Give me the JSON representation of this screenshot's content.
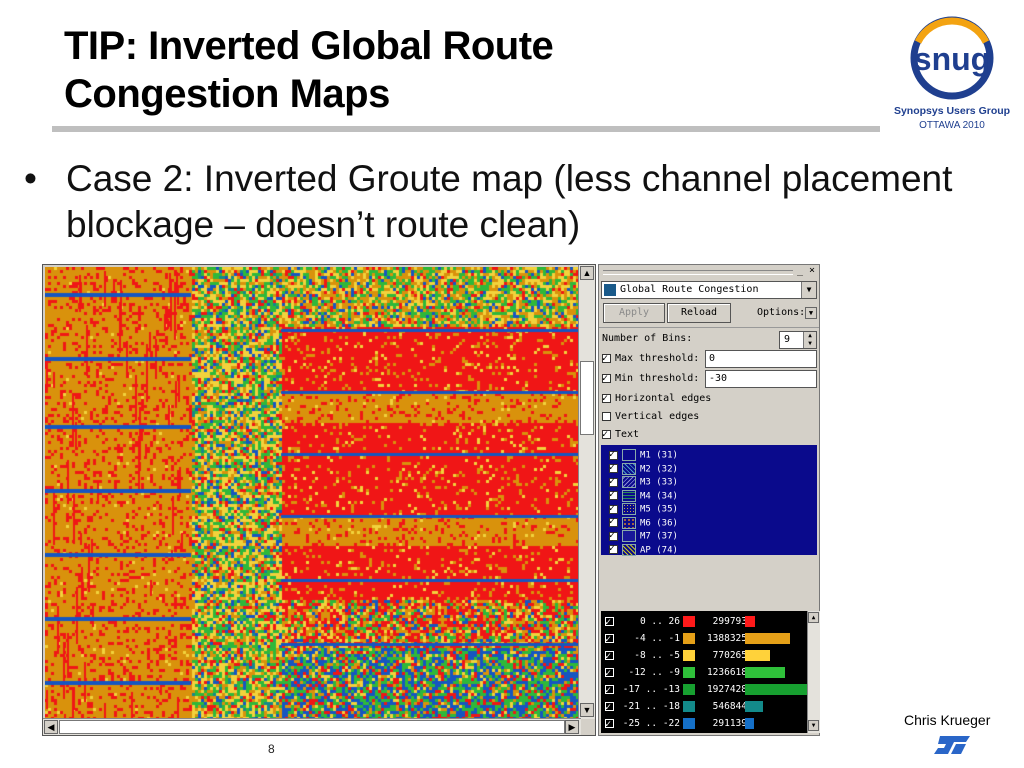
{
  "slide": {
    "title_line1": "TIP: Inverted Global Route",
    "title_line2": "Congestion Maps",
    "bullet_marker": "•",
    "bullet_text": "Case 2: Inverted Groute map (less channel placement blockage – doesn’t route clean)",
    "author": "Chris Krueger",
    "page_number": "8"
  },
  "logo": {
    "wordmark": "snug",
    "org": "Synopsys Users Group",
    "event": "OTTAWA 2010",
    "ring_color": "#1f3f8f",
    "accent_color": "#f3a312"
  },
  "panel": {
    "window_controls": "_ ×",
    "mode_select": "Global Route Congestion",
    "apply_label": "Apply",
    "reload_label": "Reload",
    "options_label": "Options:",
    "bins_label": "Number of Bins:",
    "bins_value": "9",
    "max_threshold_label": "Max threshold:",
    "max_threshold_value": "0",
    "min_threshold_label": "Min threshold:",
    "min_threshold_value": "-30",
    "horizontal_edges_label": "Horizontal edges",
    "vertical_edges_label": "Vertical edges",
    "text_label": "Text",
    "max_checked": true,
    "min_checked": true,
    "horizontal_checked": true,
    "vertical_checked": false,
    "text_checked": true,
    "layers": [
      {
        "label": "M1 (31)",
        "checked": true
      },
      {
        "label": "M2 (32)",
        "checked": true
      },
      {
        "label": "M3 (33)",
        "checked": true
      },
      {
        "label": "M4 (34)",
        "checked": true
      },
      {
        "label": "M5 (35)",
        "checked": true
      },
      {
        "label": "M6 (36)",
        "checked": true
      },
      {
        "label": "M7 (37)",
        "checked": true
      },
      {
        "label": "AP (74)",
        "checked": true
      }
    ],
    "bins": [
      {
        "range": "0 .. 26",
        "count": "299793",
        "value": 299793,
        "color": "#ff1a1a"
      },
      {
        "range": "-4 .. -1",
        "count": "1388325",
        "value": 1388325,
        "color": "#e5a018"
      },
      {
        "range": "-8 .. -5",
        "count": "770265",
        "value": 770265,
        "color": "#ffd23a"
      },
      {
        "range": "-12 .. -9",
        "count": "1236618",
        "value": 1236618,
        "color": "#2fc03a"
      },
      {
        "range": "-17 .. -13",
        "count": "1927428",
        "value": 1927428,
        "color": "#17a030"
      },
      {
        "range": "-21 .. -18",
        "count": "546844",
        "value": 546844,
        "color": "#138a8a"
      },
      {
        "range": "-25 .. -22",
        "count": "291139",
        "value": 291139,
        "color": "#1570c8"
      }
    ]
  },
  "map_colors": {
    "orange": "#d9920c",
    "red": "#f01616",
    "yellow": "#f2d23c",
    "green": "#2fb83a",
    "blue": "#1656c0",
    "teal": "#148a8a"
  }
}
